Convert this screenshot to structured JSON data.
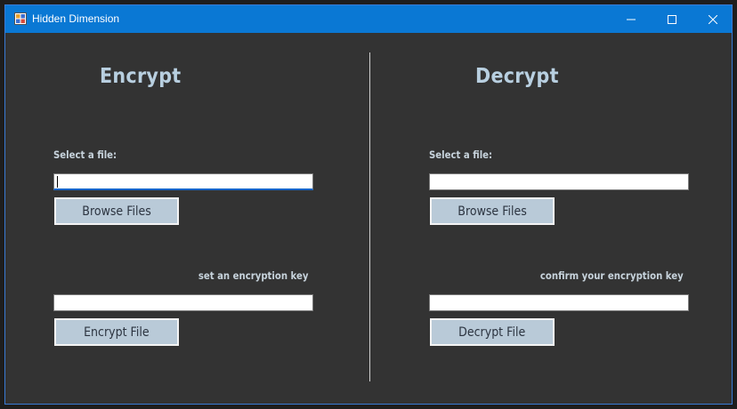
{
  "window": {
    "title": "Hidden Dimension",
    "controls": {
      "minimize": "minimize-icon",
      "maximize": "maximize-icon",
      "close": "close-icon"
    }
  },
  "encrypt": {
    "heading": "Encrypt",
    "file_label": "Select a file:",
    "file_value": "",
    "browse_label": "Browse Files",
    "key_label": "set an encryption key",
    "key_value": "",
    "action_label": "Encrypt File"
  },
  "decrypt": {
    "heading": "Decrypt",
    "file_label": "Select a file:",
    "file_value": "",
    "browse_label": "Browse Files",
    "key_label": "confirm your encryption key",
    "key_value": "",
    "action_label": "Decrypt File"
  },
  "colors": {
    "titlebar": "#0a78d4",
    "background": "#333333",
    "heading": "#b8cfe0",
    "button": "#b9cad8"
  }
}
